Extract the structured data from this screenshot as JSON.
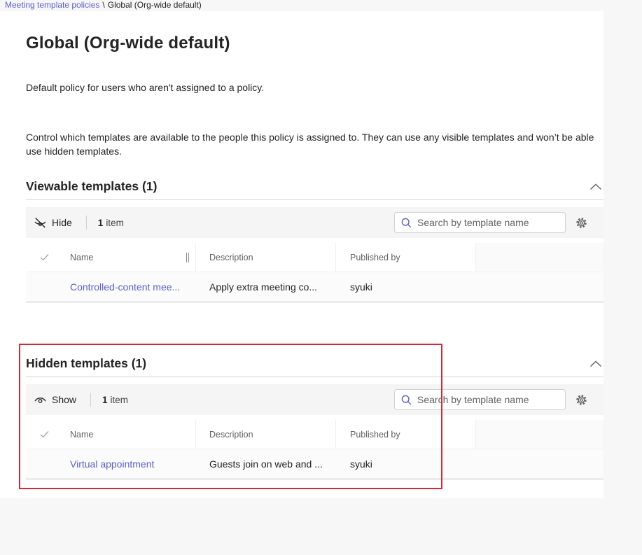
{
  "colors": {
    "accent": "#5b5fc7",
    "link": "#5b5fc7",
    "highlight_red": "#d42a34",
    "toolbar_bg": "#f5f5f5",
    "page_bg": "#f7f7f7"
  },
  "breadcrumb": {
    "parent": "Meeting template policies",
    "separator": "\\",
    "current": "Global (Org-wide default)"
  },
  "page": {
    "title": "Global (Org-wide default)",
    "subtitle": "Default policy for users who aren't assigned to a policy.",
    "description_line1": "Control which templates are available to the people this policy is assigned to. They can use any visible templates and won’t be able",
    "description_line2": "use hidden templates."
  },
  "sections": [
    {
      "title": "Viewable templates (1)",
      "collapse_icon": "chevron-up-icon",
      "toolbar": {
        "action_icon": "eye-off-icon",
        "action_label": "Hide",
        "count": "1",
        "count_unit": "item",
        "search_icon": "search-icon",
        "search_placeholder": "Search by template name",
        "settings_icon": "gear-icon"
      },
      "columns": [
        "Name",
        "Description",
        "Published by"
      ],
      "rows": [
        {
          "name": "Controlled-content mee...",
          "description": "Apply extra meeting co...",
          "published_by": "syuki"
        }
      ]
    },
    {
      "title": "Hidden templates (1)",
      "collapse_icon": "chevron-up-icon",
      "toolbar": {
        "action_icon": "eye-icon",
        "action_label": "Show",
        "count": "1",
        "count_unit": "item",
        "search_icon": "search-icon",
        "search_placeholder": "Search by template name",
        "settings_icon": "gear-icon"
      },
      "columns": [
        "Name",
        "Description",
        "Published by"
      ],
      "rows": [
        {
          "name": "Virtual appointment",
          "description": "Guests join on web and ...",
          "published_by": "syuki"
        }
      ]
    }
  ]
}
